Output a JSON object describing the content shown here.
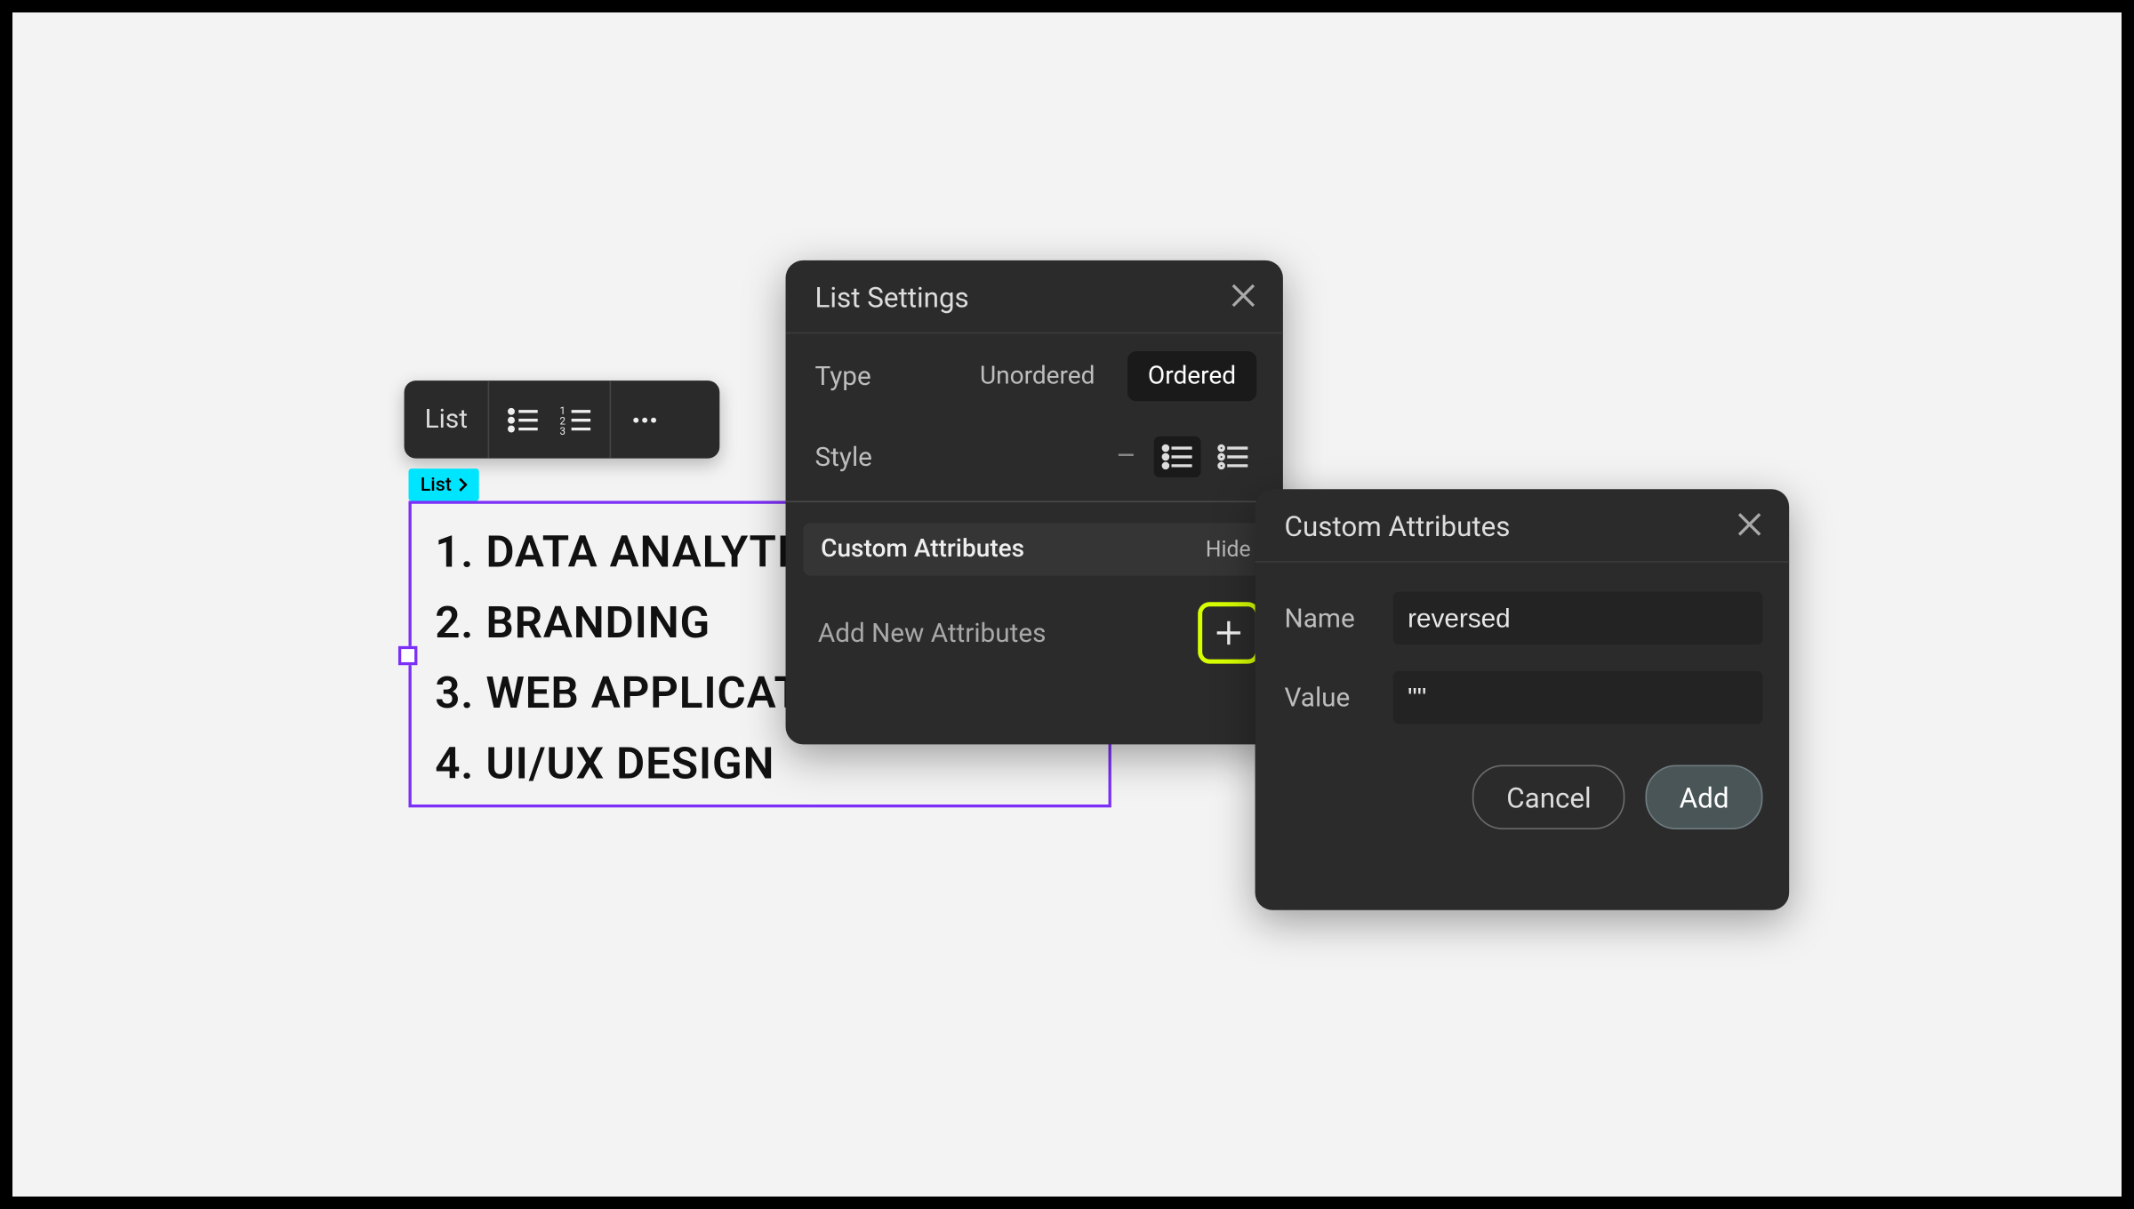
{
  "toolbar": {
    "label": "List"
  },
  "tag": {
    "label": "List"
  },
  "list_items": [
    "DATA ANALYTICS",
    "BRANDING",
    "WEB APPLICATIONS",
    "UI/UX DESIGN"
  ],
  "panel_settings": {
    "title": "List Settings",
    "type_label": "Type",
    "type_unordered": "Unordered",
    "type_ordered": "Ordered",
    "type_selected": "Ordered",
    "style_label": "Style",
    "custom_attr_heading": "Custom Attributes",
    "hide_label": "Hide",
    "add_new_label": "Add New Attributes"
  },
  "panel_attr": {
    "title": "Custom Attributes",
    "name_label": "Name",
    "name_value": "reversed",
    "value_label": "Value",
    "value_value": "\"\"",
    "cancel": "Cancel",
    "add": "Add"
  }
}
